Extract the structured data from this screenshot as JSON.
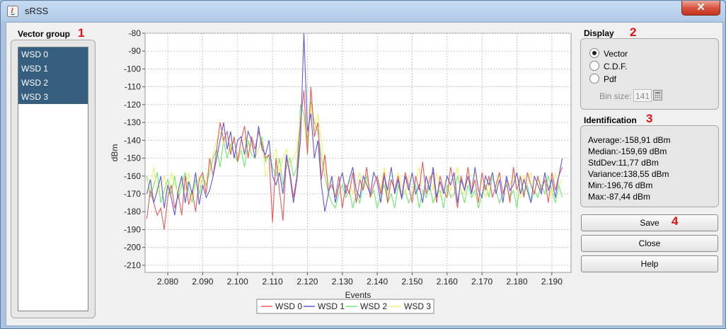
{
  "window": {
    "title": "sRSS",
    "close_glyph": "✕"
  },
  "vector_group": {
    "title": "Vector group",
    "marker": "1",
    "items": [
      "WSD 0",
      "WSD 1",
      "WSD 2",
      "WSD 3"
    ]
  },
  "display": {
    "title": "Display",
    "marker": "2",
    "options": [
      {
        "label": "Vector",
        "selected": true
      },
      {
        "label": "C.D.F.",
        "selected": false
      },
      {
        "label": "Pdf",
        "selected": false
      }
    ],
    "bin_size_label": "Bin size:",
    "bin_size_value": "141"
  },
  "identification": {
    "title": "Identification",
    "marker": "3",
    "stats": [
      "Average:-158,91 dBm",
      "Median:-159,69 dBm",
      "StdDev:11,77 dBm",
      "Variance:138,55 dBm",
      "Min:-196,76 dBm",
      "Max:-87,44 dBm"
    ]
  },
  "buttons": {
    "save": "Save",
    "save_marker": "4",
    "close": "Close",
    "help": "Help"
  },
  "colors": {
    "wsd0": "#e85a5a",
    "wsd1": "#5a5ae0",
    "wsd2": "#6ee86e",
    "wsd3": "#f0f070"
  },
  "chart_data": {
    "type": "line",
    "xlabel": "Events",
    "ylabel": "dBm",
    "xlim": [
      2.0735,
      2.1955
    ],
    "ylim": [
      -214,
      -80
    ],
    "x_ticks": [
      "2.080",
      "2.090",
      "2.100",
      "2.110",
      "2.120",
      "2.130",
      "2.140",
      "2.150",
      "2.160",
      "2.170",
      "2.180",
      "2.190"
    ],
    "y_ticks": [
      "-80",
      "-90",
      "-100",
      "-110",
      "-120",
      "-130",
      "-140",
      "-150",
      "-160",
      "-170",
      "-180",
      "-190",
      "-200",
      "-210"
    ],
    "grid": true,
    "legend_position": "bottom",
    "x": [
      2.074,
      2.075,
      2.076,
      2.077,
      2.078,
      2.079,
      2.08,
      2.081,
      2.082,
      2.083,
      2.084,
      2.085,
      2.086,
      2.087,
      2.088,
      2.089,
      2.09,
      2.091,
      2.092,
      2.093,
      2.094,
      2.095,
      2.096,
      2.097,
      2.098,
      2.099,
      2.1,
      2.101,
      2.102,
      2.103,
      2.104,
      2.105,
      2.106,
      2.107,
      2.108,
      2.109,
      2.11,
      2.111,
      2.112,
      2.113,
      2.114,
      2.115,
      2.116,
      2.117,
      2.118,
      2.119,
      2.12,
      2.121,
      2.122,
      2.123,
      2.124,
      2.125,
      2.126,
      2.127,
      2.128,
      2.129,
      2.13,
      2.131,
      2.132,
      2.133,
      2.134,
      2.135,
      2.136,
      2.137,
      2.138,
      2.139,
      2.14,
      2.141,
      2.142,
      2.143,
      2.144,
      2.145,
      2.146,
      2.147,
      2.148,
      2.149,
      2.15,
      2.151,
      2.152,
      2.153,
      2.154,
      2.155,
      2.156,
      2.157,
      2.158,
      2.159,
      2.16,
      2.161,
      2.162,
      2.163,
      2.164,
      2.165,
      2.166,
      2.167,
      2.168,
      2.169,
      2.17,
      2.171,
      2.172,
      2.173,
      2.174,
      2.175,
      2.176,
      2.177,
      2.178,
      2.179,
      2.18,
      2.181,
      2.182,
      2.183,
      2.184,
      2.185,
      2.186,
      2.187,
      2.188,
      2.189,
      2.19,
      2.191,
      2.192,
      2.193,
      2.194,
      2.195
    ],
    "series": [
      {
        "name": "WSD 0",
        "values": [
          -184,
          -168,
          -175,
          -182,
          -178,
          -190,
          -172,
          -165,
          -178,
          -170,
          -182,
          -160,
          -176,
          -168,
          -180,
          -162,
          -158,
          -170,
          -150,
          -160,
          -145,
          -130,
          -140,
          -135,
          -148,
          -138,
          -152,
          -140,
          -132,
          -150,
          -138,
          -145,
          -135,
          -142,
          -150,
          -148,
          -186,
          -150,
          -168,
          -185,
          -150,
          -158,
          -172,
          -160,
          -130,
          -112,
          -148,
          -110,
          -138,
          -130,
          -162,
          -148,
          -168,
          -165,
          -172,
          -160,
          -178,
          -165,
          -170,
          -158,
          -175,
          -162,
          -168,
          -155,
          -172,
          -165,
          -160,
          -170,
          -158,
          -175,
          -162,
          -168,
          -160,
          -172,
          -158,
          -165,
          -175,
          -160,
          -168,
          -152,
          -170,
          -162,
          -158,
          -175,
          -160,
          -168,
          -172,
          -155,
          -165,
          -178,
          -160,
          -168,
          -155,
          -170,
          -162,
          -175,
          -158,
          -168,
          -160,
          -172,
          -165,
          -158,
          -170,
          -162,
          -175,
          -155,
          -168,
          -160,
          -172,
          -158,
          -165,
          -170,
          -160,
          -168,
          -162,
          -175,
          -158,
          -168,
          -160,
          -155
        ]
      },
      {
        "name": "WSD 1",
        "values": [
          -170,
          -162,
          -175,
          -168,
          -160,
          -178,
          -165,
          -172,
          -182,
          -168,
          -160,
          -175,
          -163,
          -170,
          -158,
          -176,
          -165,
          -172,
          -168,
          -160,
          -150,
          -140,
          -130,
          -145,
          -135,
          -150,
          -140,
          -138,
          -148,
          -135,
          -140,
          -150,
          -132,
          -145,
          -148,
          -140,
          -160,
          -165,
          -158,
          -170,
          -148,
          -160,
          -175,
          -162,
          -140,
          -80,
          -135,
          -125,
          -150,
          -140,
          -165,
          -180,
          -170,
          -160,
          -175,
          -165,
          -158,
          -170,
          -162,
          -155,
          -168,
          -172,
          -160,
          -165,
          -170,
          -158,
          -163,
          -175,
          -160,
          -168,
          -155,
          -170,
          -162,
          -173,
          -160,
          -168,
          -158,
          -170,
          -165,
          -175,
          -160,
          -168,
          -155,
          -172,
          -163,
          -170,
          -160,
          -165,
          -158,
          -175,
          -162,
          -168,
          -160,
          -170,
          -155,
          -168,
          -172,
          -160,
          -165,
          -158,
          -170,
          -162,
          -175,
          -160,
          -168,
          -165,
          -158,
          -170,
          -162,
          -168,
          -175,
          -160,
          -165,
          -170,
          -158,
          -168,
          -162,
          -172,
          -160,
          -150
        ]
      },
      {
        "name": "WSD 2",
        "values": [
          -160,
          -172,
          -165,
          -158,
          -175,
          -168,
          -162,
          -170,
          -160,
          -173,
          -165,
          -158,
          -168,
          -175,
          -162,
          -170,
          -160,
          -165,
          -158,
          -150,
          -145,
          -155,
          -140,
          -150,
          -142,
          -148,
          -152,
          -145,
          -155,
          -140,
          -148,
          -150,
          -145,
          -138,
          -152,
          -148,
          -155,
          -160,
          -150,
          -165,
          -155,
          -150,
          -160,
          -155,
          -120,
          -125,
          -140,
          -118,
          -130,
          -135,
          -150,
          -160,
          -170,
          -175,
          -178,
          -170,
          -165,
          -172,
          -168,
          -178,
          -170,
          -175,
          -165,
          -160,
          -172,
          -168,
          -178,
          -170,
          -165,
          -175,
          -170,
          -178,
          -165,
          -172,
          -168,
          -175,
          -170,
          -165,
          -178,
          -168,
          -172,
          -165,
          -175,
          -170,
          -168,
          -178,
          -165,
          -172,
          -170,
          -160,
          -168,
          -175,
          -165,
          -172,
          -168,
          -178,
          -170,
          -165,
          -172,
          -160,
          -168,
          -175,
          -170,
          -165,
          -172,
          -168,
          -178,
          -160,
          -170,
          -165,
          -175,
          -168,
          -172,
          -165,
          -170,
          -160,
          -168,
          -175,
          -165,
          -172
        ]
      },
      {
        "name": "WSD 3",
        "values": [
          -162,
          -168,
          -155,
          -170,
          -165,
          -160,
          -172,
          -158,
          -165,
          -170,
          -162,
          -168,
          -158,
          -172,
          -165,
          -160,
          -168,
          -162,
          -155,
          -148,
          -140,
          -135,
          -142,
          -138,
          -145,
          -140,
          -150,
          -145,
          -138,
          -148,
          -142,
          -150,
          -145,
          -140,
          -160,
          -155,
          -150,
          -145,
          -158,
          -150,
          -145,
          -155,
          -150,
          -145,
          -125,
          -130,
          -145,
          -120,
          -135,
          -125,
          -140,
          -155,
          -165,
          -160,
          -172,
          -165,
          -158,
          -168,
          -162,
          -170,
          -165,
          -158,
          -168,
          -162,
          -172,
          -165,
          -160,
          -168,
          -155,
          -170,
          -162,
          -168,
          -158,
          -165,
          -170,
          -160,
          -168,
          -162,
          -155,
          -170,
          -165,
          -160,
          -168,
          -158,
          -172,
          -165,
          -160,
          -168,
          -162,
          -155,
          -168,
          -170,
          -160,
          -165,
          -158,
          -168,
          -162,
          -172,
          -165,
          -160,
          -168,
          -158,
          -170,
          -162,
          -165,
          -160,
          -168,
          -172,
          -160,
          -165,
          -158,
          -170,
          -162,
          -168,
          -160,
          -165,
          -172,
          -158,
          -165,
          -162
        ]
      }
    ]
  }
}
